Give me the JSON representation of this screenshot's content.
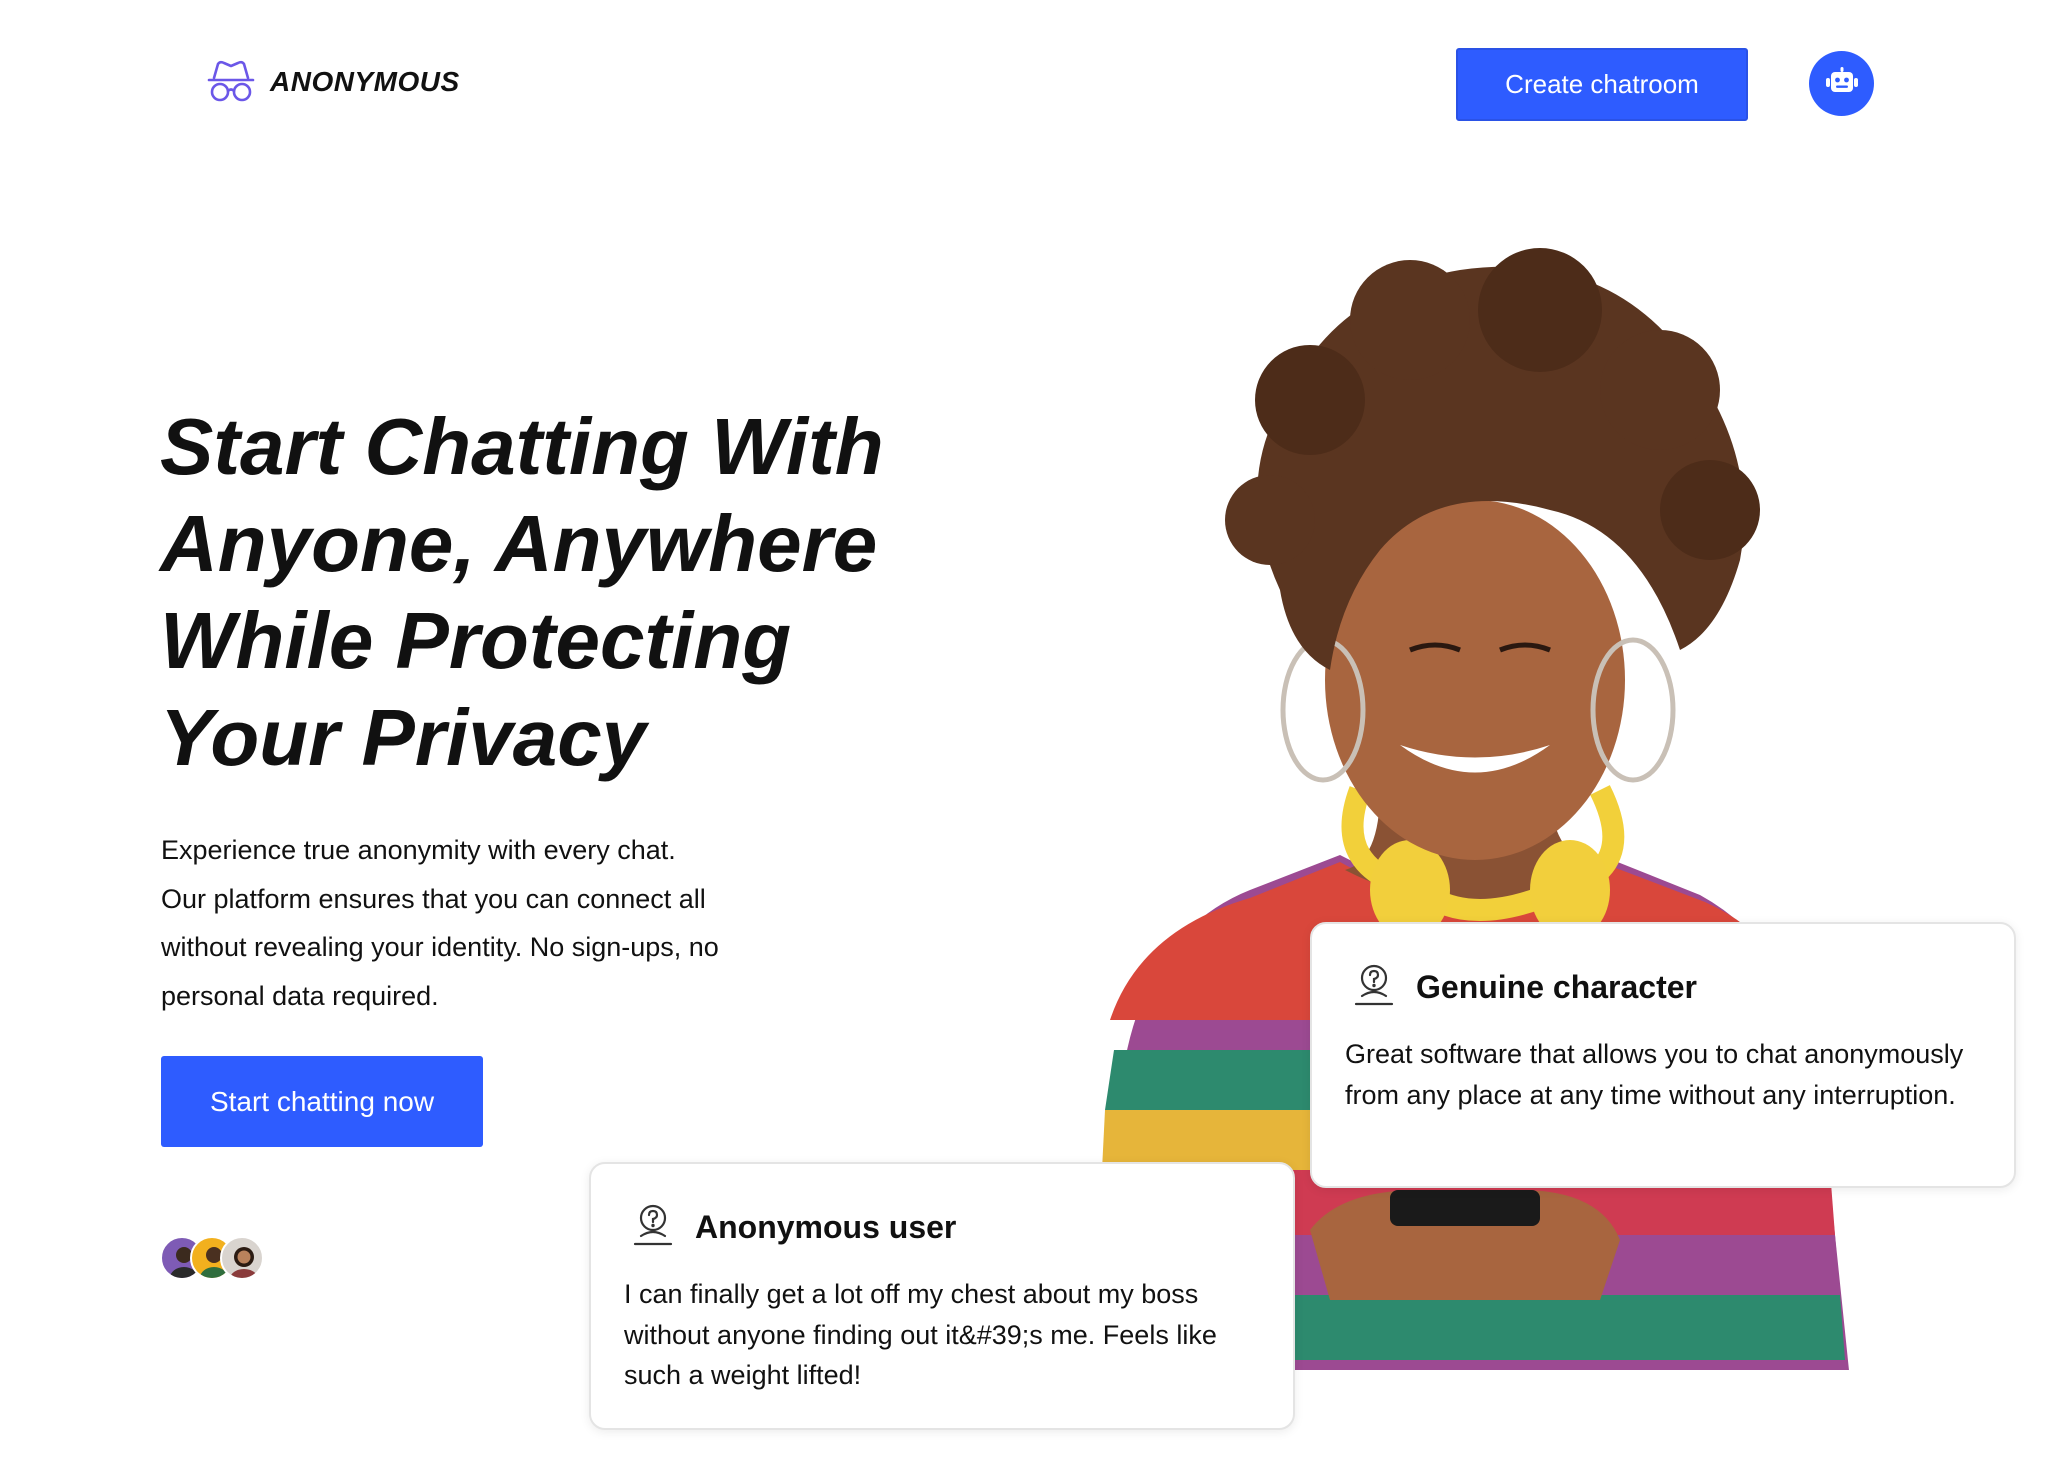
{
  "header": {
    "logo_text": "ANONYMOUS",
    "logo_icon": "incognito-icon",
    "create_button_label": "Create chatroom",
    "bot_button_icon": "robot-icon"
  },
  "hero": {
    "title": "Start Chatting With Anyone, Anywhere While Protecting Your Privacy",
    "description": "Experience true anonymity with every chat. Our platform ensures that you can connect all without revealing your identity. No sign-ups, no personal data required.",
    "cta_label": "Start chatting now"
  },
  "testimonials": [
    {
      "icon": "anonymous-user-icon",
      "title": "Genuine character",
      "text": "Great software that allows you to chat anonymously from any place at any time without any interruption."
    },
    {
      "icon": "anonymous-user-icon",
      "title": "Anonymous user",
      "text": "I can finally get a lot off my chest about my boss without anyone finding out it&#39;s me. Feels like such a weight lifted!"
    }
  ],
  "colors": {
    "accent": "#2e5cff",
    "text": "#111111",
    "card_border": "#e4e4e4"
  }
}
